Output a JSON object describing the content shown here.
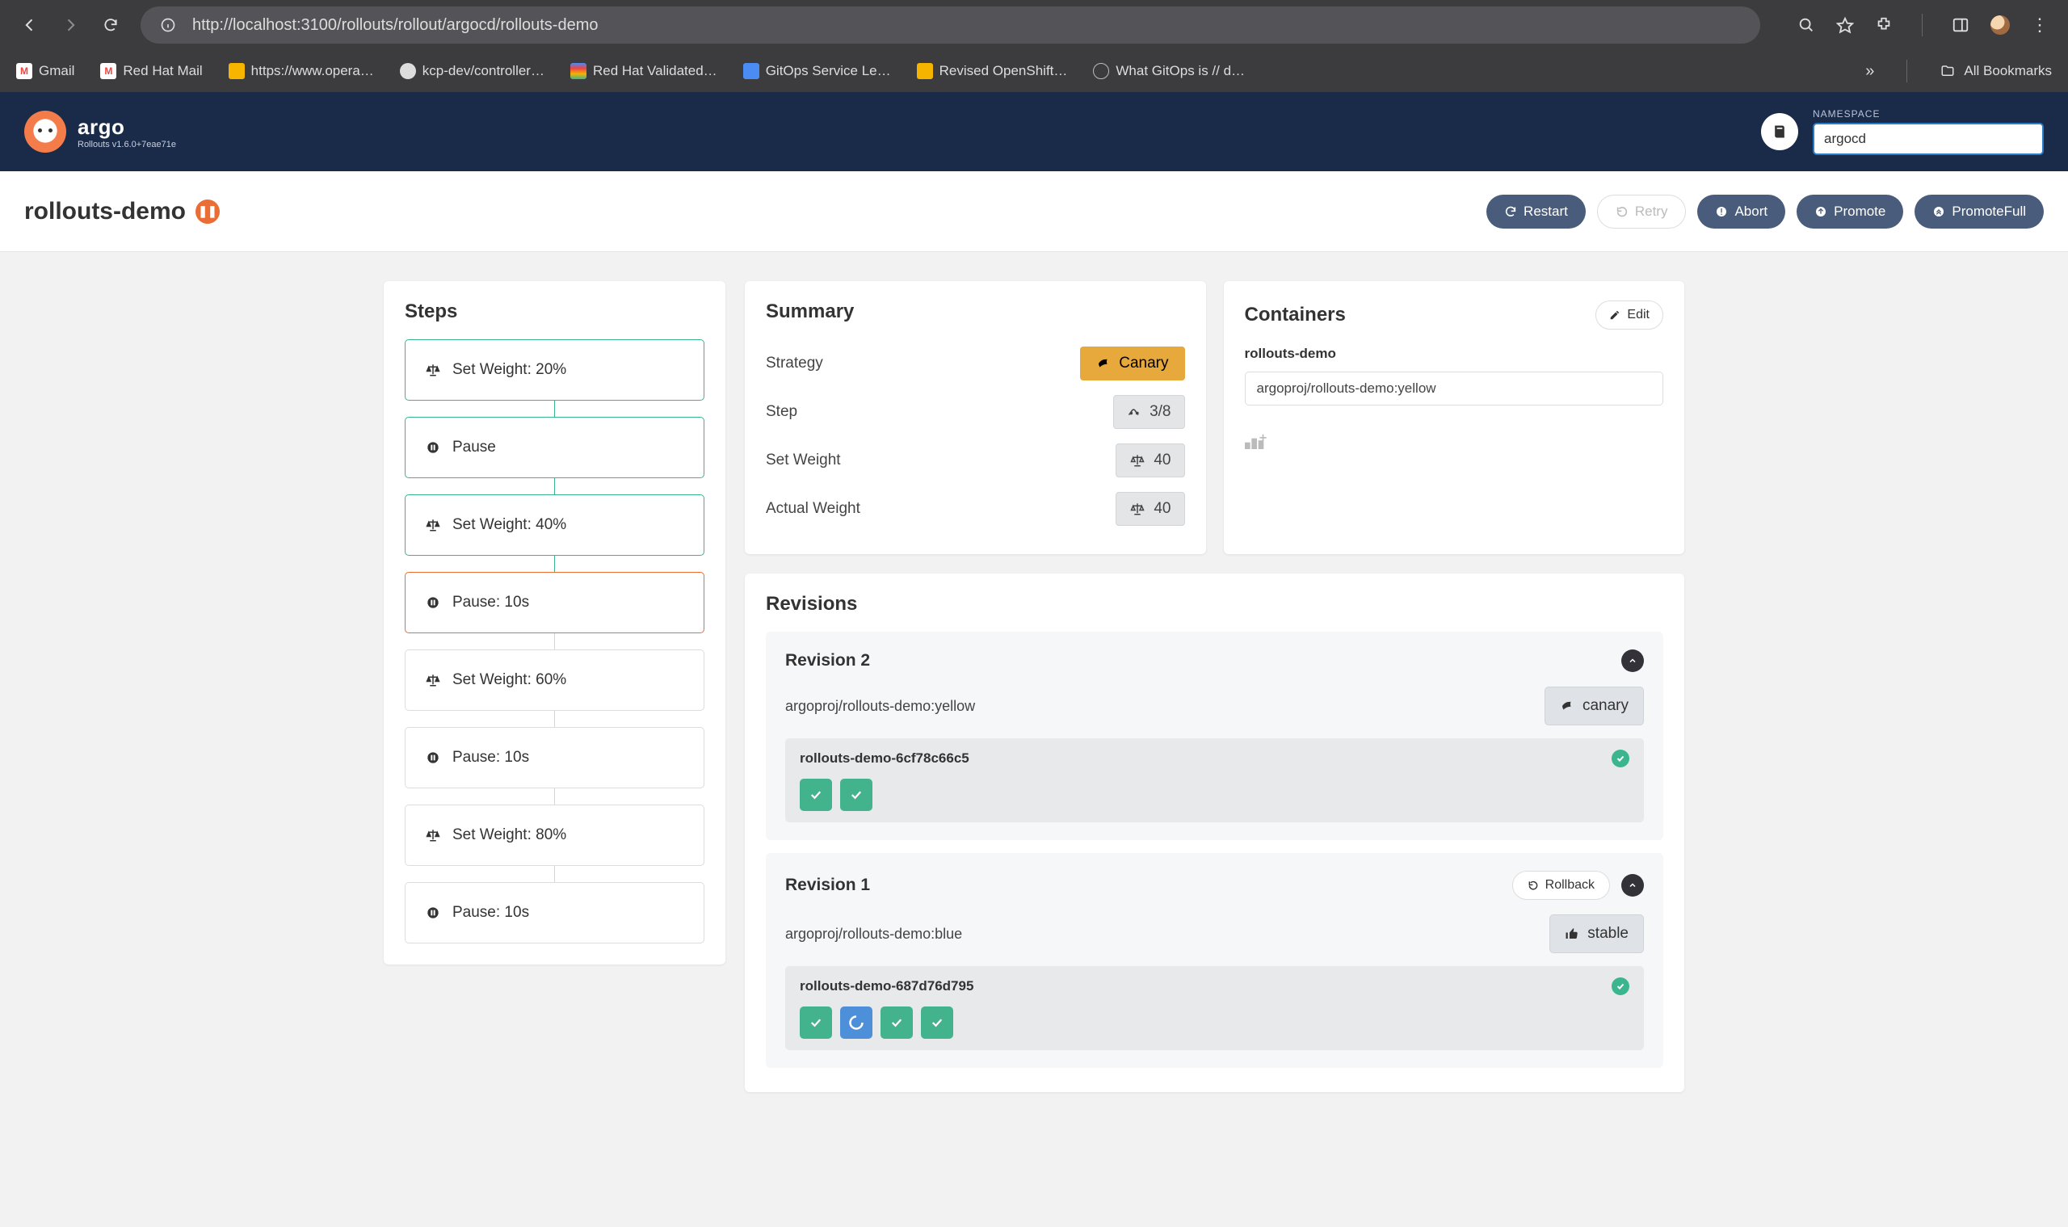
{
  "browser": {
    "url": "http://localhost:3100/rollouts/rollout/argocd/rollouts-demo",
    "bookmarks": [
      "Gmail",
      "Red Hat Mail",
      "https://www.opera…",
      "kcp-dev/controller…",
      "Red Hat Validated…",
      "GitOps Service Le…",
      "Revised OpenShift…",
      "What GitOps is // d…"
    ],
    "all_bookmarks": "All Bookmarks"
  },
  "app": {
    "brand": "argo",
    "version": "Rollouts v1.6.0+7eae71e",
    "namespace_label": "NAMESPACE",
    "namespace_value": "argocd"
  },
  "page": {
    "title": "rollouts-demo",
    "actions": {
      "restart": "Restart",
      "retry": "Retry",
      "abort": "Abort",
      "promote": "Promote",
      "promote_full": "PromoteFull"
    }
  },
  "steps": {
    "heading": "Steps",
    "items": [
      {
        "label": "Set Weight: 20%",
        "type": "weight",
        "state": "done"
      },
      {
        "label": "Pause",
        "type": "pause",
        "state": "done"
      },
      {
        "label": "Set Weight: 40%",
        "type": "weight",
        "state": "done"
      },
      {
        "label": "Pause: 10s",
        "type": "pause",
        "state": "active"
      },
      {
        "label": "Set Weight: 60%",
        "type": "weight",
        "state": "pending"
      },
      {
        "label": "Pause: 10s",
        "type": "pause",
        "state": "pending"
      },
      {
        "label": "Set Weight: 80%",
        "type": "weight",
        "state": "pending"
      },
      {
        "label": "Pause: 10s",
        "type": "pause",
        "state": "pending"
      }
    ]
  },
  "summary": {
    "heading": "Summary",
    "strategy_label": "Strategy",
    "strategy_value": "Canary",
    "step_label": "Step",
    "step_value": "3/8",
    "set_weight_label": "Set Weight",
    "set_weight_value": "40",
    "actual_weight_label": "Actual Weight",
    "actual_weight_value": "40"
  },
  "containers": {
    "heading": "Containers",
    "edit": "Edit",
    "name": "rollouts-demo",
    "image": "argoproj/rollouts-demo:yellow"
  },
  "revisions": {
    "heading": "Revisions",
    "list": [
      {
        "title": "Revision 2",
        "image": "argoproj/rollouts-demo:yellow",
        "tag": "canary",
        "rs_name": "rollouts-demo-6cf78c66c5",
        "pods": [
          "ok",
          "ok"
        ],
        "rollback": false
      },
      {
        "title": "Revision 1",
        "image": "argoproj/rollouts-demo:blue",
        "tag": "stable",
        "rs_name": "rollouts-demo-687d76d795",
        "pods": [
          "ok",
          "spin",
          "ok",
          "ok"
        ],
        "rollback": true,
        "rollback_label": "Rollback"
      }
    ]
  }
}
